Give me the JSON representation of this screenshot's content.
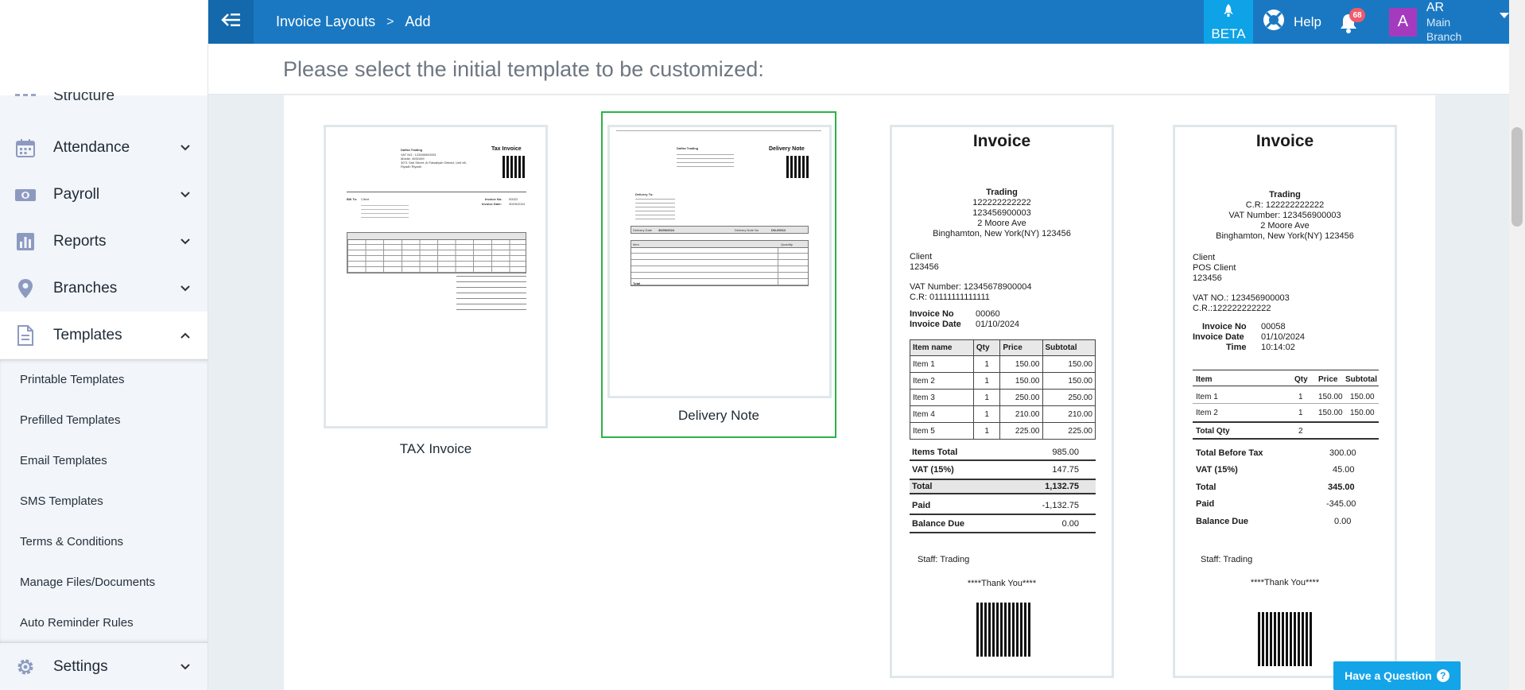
{
  "header": {
    "breadcrumb_parent": "Invoice Layouts",
    "breadcrumb_sep": ">",
    "breadcrumb_current": "Add",
    "beta_label": "BETA",
    "help_label": "Help",
    "notifications_count": "68",
    "user_initial": "A",
    "user_name": "AR",
    "user_branch": "Main Branch"
  },
  "sidebar": {
    "partial_item": "Structure",
    "items": [
      {
        "label": "Attendance",
        "icon": "calendar-icon"
      },
      {
        "label": "Payroll",
        "icon": "money-icon"
      },
      {
        "label": "Reports",
        "icon": "bar-chart-icon"
      },
      {
        "label": "Branches",
        "icon": "map-pin-icon"
      },
      {
        "label": "Templates",
        "icon": "document-icon"
      }
    ],
    "sub_items": [
      "Printable Templates",
      "Prefilled Templates",
      "Email Templates",
      "SMS Templates",
      "Terms & Conditions",
      "Manage Files/Documents",
      "Auto Reminder Rules"
    ],
    "settings_label": "Settings"
  },
  "main": {
    "heading": "Please select the initial template to be customized:",
    "templates": [
      {
        "name": "TAX Invoice",
        "selected": false
      },
      {
        "name": "Delivery Note",
        "selected": true
      }
    ]
  },
  "tax_thumb": {
    "company": "Daftra Trading",
    "title": "Tax Invoice",
    "addr1": "VAT NO.: 123456900003",
    "addr2": "Mobile: 4592499",
    "addr3": "3071 Sari Street, Al Faisaliyah District, Unit #6,",
    "addr4": "Riyadh Riyadh",
    "bill_to": "Bill To:",
    "client": "Client",
    "invoice_no_label": "Invoice No:",
    "invoice_no": "00022",
    "invoice_date_label": "Invoice Date:",
    "invoice_date": "30/09/2024"
  },
  "delivery_thumb": {
    "company": "Daftra Trading",
    "title": "Delivery Note",
    "deliver_to": "Delivery To:",
    "date_label": "Delivery Date",
    "date": "30/09/2024",
    "no_label": "Delivery Note No",
    "no": "DN-00012",
    "item_col": "Item",
    "qty_col": "Quantity",
    "total": "Total"
  },
  "receipt1": {
    "title": "Invoice",
    "company": "Trading",
    "phone": "122222222222",
    "vat": "123456900003",
    "street": "2 Moore Ave",
    "city": "Binghamton, New York(NY) 123456",
    "client": "Client",
    "client_no": "123456",
    "vat_number": "VAT Number: 12345678900004",
    "cr": "C.R: 01111111111111",
    "inv_no_label": "Invoice No",
    "inv_no": "00060",
    "inv_date_label": "Invoice Date",
    "inv_date": "01/10/2024",
    "col_item": "Item name",
    "col_qty": "Qty",
    "col_price": "Price",
    "col_subtotal": "Subtotal",
    "rows": [
      {
        "item": "Item 1",
        "qty": "1",
        "price": "150.00",
        "subtotal": "150.00"
      },
      {
        "item": "Item 2",
        "qty": "1",
        "price": "150.00",
        "subtotal": "150.00"
      },
      {
        "item": "Item 3",
        "qty": "1",
        "price": "250.00",
        "subtotal": "250.00"
      },
      {
        "item": "Item 4",
        "qty": "1",
        "price": "210.00",
        "subtotal": "210.00"
      },
      {
        "item": "Item 5",
        "qty": "1",
        "price": "225.00",
        "subtotal": "225.00"
      }
    ],
    "items_total_label": "Items Total",
    "items_total": "985.00",
    "vat_label": "VAT (15%)",
    "vat_value": "147.75",
    "total_label": "Total",
    "total": "1,132.75",
    "paid_label": "Paid",
    "paid": "-1,132.75",
    "balance_label": "Balance Due",
    "balance": "0.00",
    "staff": "Staff:  Trading",
    "thanks": "****Thank You****"
  },
  "receipt2": {
    "title": "Invoice",
    "company": "Trading",
    "cr": "C.R: 122222222222",
    "vat": "VAT Number: 123456900003",
    "street": "2 Moore Ave",
    "city": "Binghamton, New York(NY) 123456",
    "client": "Client",
    "pos_client": "POS Client",
    "client_no": "123456",
    "vat_no": "VAT NO.: 123456900003",
    "cr2": "C.R.:122222222222",
    "inv_no_label": "Invoice No",
    "inv_no": "00058",
    "inv_date_label": "Invoice Date",
    "inv_date": "01/10/2024",
    "time_label": "Time",
    "time": "10:14:02",
    "col_item": "Item",
    "col_qty": "Qty",
    "col_price": "Price",
    "col_subtotal": "Subtotal",
    "rows": [
      {
        "item": "Item 1",
        "qty": "1",
        "price": "150.00",
        "subtotal": "150.00"
      },
      {
        "item": "Item 2",
        "qty": "1",
        "price": "150.00",
        "subtotal": "150.00"
      }
    ],
    "total_qty_label": "Total Qty",
    "total_qty": "2",
    "before_tax_label": "Total Before Tax",
    "before_tax": "300.00",
    "vat_label": "VAT (15%)",
    "vat_value": "45.00",
    "total_label": "Total",
    "total": "345.00",
    "paid_label": "Paid",
    "paid": "-345.00",
    "balance_label": "Balance Due",
    "balance": "0.00",
    "staff": "Staff:  Trading",
    "thanks": "****Thank You****"
  },
  "help_widget": {
    "label": "Have a Question",
    "q": "?"
  },
  "colors": {
    "topbar": "#1a78c2",
    "beta": "#0ea2e6",
    "selected_border": "#2bb24c",
    "badge": "#ef5b6b",
    "avatar": "#a43bbf"
  }
}
